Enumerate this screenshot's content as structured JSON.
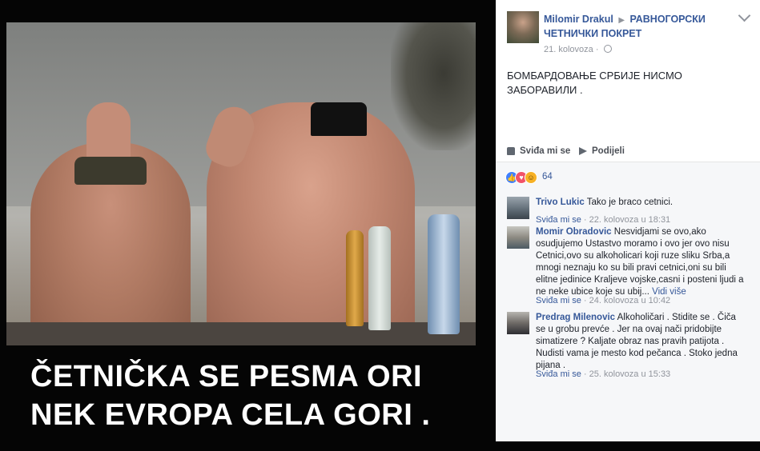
{
  "caption": {
    "line1": "ČETNIČKA SE PESMA ORI",
    "line2": "NEK EVROPA CELA GORI ."
  },
  "post": {
    "author": "Milomir Drakul",
    "arrow": "▶",
    "group": "РАВНОГОРСКИ ЧЕТНИЧКИ ПОКРЕТ",
    "date": "21. kolovoza",
    "date_sep": "·",
    "text": "БОМБАРДОВАЊЕ СРБИЈЕ НИСМО ЗАБОРАВИЛИ ."
  },
  "actions": {
    "like": "Sviđa mi se",
    "share": "Podijeli"
  },
  "reactions": {
    "count": "64",
    "icons": [
      "like-reaction",
      "love-reaction",
      "haha-reaction"
    ]
  },
  "comments": [
    {
      "name": "Trivo Lukic",
      "text": "Tako je braco cetnici.",
      "like": "Sviđa mi se",
      "sep": "·",
      "time": "22. kolovoza u 18:31"
    },
    {
      "name": "Momir Obradovic",
      "text": "Nesvidjami se ovo,ako osudjujemo Ustastvo moramo i ovo jer ovo nisu Cetnici,ovo su alkoholicari koji ruze sliku Srba,a mnogi neznaju ko su bili pravi cetnici,oni su bili elitne jedinice Kraljeve vojske,casni i posteni ljudi a ne neke ubice koje su ubij...",
      "see_more": "Vidi više",
      "like": "Sviđa mi se",
      "sep": "·",
      "time": "24. kolovoza u 10:42"
    },
    {
      "name": "Predrag Milenovic",
      "text": "Alkoholičari . Stidite se . Čiča se u grobu prevće . Jer na ovaj nači pridobijte simatizere ? Kaljate obraz nas pravih patijota . Nudisti vama je mesto kod pečanca . Stoko jedna pijana .",
      "like": "Sviđa mi se",
      "sep": "·",
      "time": "25. kolovoza u 15:33"
    }
  ],
  "colors": {
    "link": "#365899",
    "meta": "#90949c",
    "text": "#1d2129",
    "panel": "#f6f7f9"
  }
}
